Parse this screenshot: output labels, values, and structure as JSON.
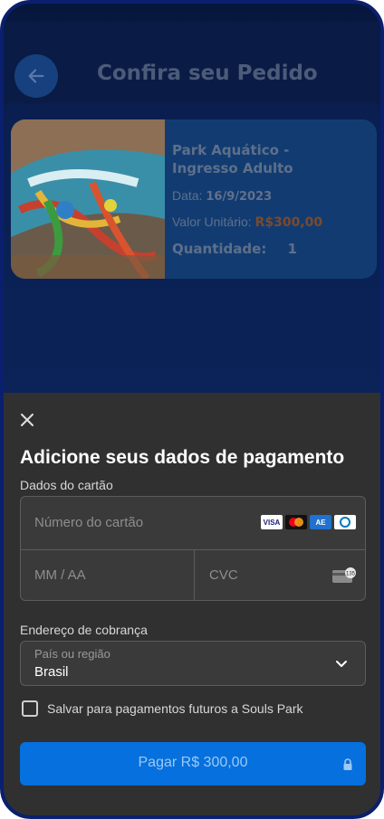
{
  "header": {
    "title": "Confira seu Pedido",
    "back_icon": "arrow-left-icon"
  },
  "order": {
    "product_name": "Park Aquático - Ingresso Adulto",
    "date_label": "Data:",
    "date_value": "16/9/2023",
    "price_label": "Valor Unitário:",
    "price_value": "R$300,00",
    "quantity_label": "Quantidade:",
    "quantity_value": "1"
  },
  "payment_sheet": {
    "close_icon": "close-icon",
    "title": "Adicione seus dados de pagamento",
    "card_section_label": "Dados do cartão",
    "card_number_placeholder": "Número do cartão",
    "card_brands": [
      "VISA",
      "Mastercard",
      "Amex",
      "Diners"
    ],
    "expiry_placeholder": "MM / AA",
    "cvc_placeholder": "CVC",
    "billing_label": "Endereço de cobrança",
    "country_label": "País ou região",
    "country_value": "Brasil",
    "save_label": "Salvar para pagamentos futuros a Souls Park",
    "pay_button_label": "Pagar R$ 300,00"
  },
  "colors": {
    "sheet_bg": "#303030",
    "pay_button": "#0570de",
    "app_bg": "#0a1f52"
  }
}
